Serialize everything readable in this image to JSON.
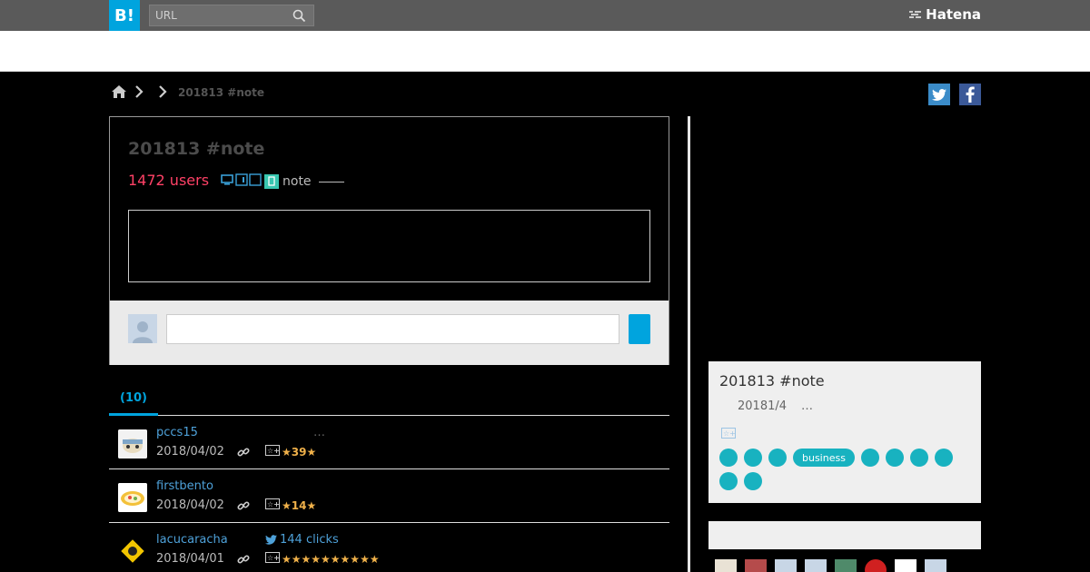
{
  "header": {
    "logo_text": "B!",
    "search_placeholder": "URL",
    "brand": "Hatena"
  },
  "breadcrumb": {
    "current": "201813 #note"
  },
  "entry": {
    "title": "201813 #note",
    "users": "1472 users",
    "category": "note"
  },
  "tabs": {
    "active_label": "(10)"
  },
  "bookmarks": [
    {
      "user": "pccs15",
      "note": "…",
      "date": "2018/04/02",
      "stars": "★39★"
    },
    {
      "user": "firstbento",
      "note": "",
      "date": "2018/04/02",
      "stars": "★14★"
    },
    {
      "user": "lacucaracha",
      "clicks": "144 clicks",
      "date": "2018/04/01",
      "stars": "★★★★★★★★★★"
    }
  ],
  "sidebar": {
    "title": "201813 #note",
    "date": "20181/4",
    "more": "…",
    "tag_pill": "business"
  },
  "colors": {
    "accent": "#00a4de",
    "users": "#ff4166",
    "tag": "#18b2c0",
    "star": "#f0b14a"
  }
}
